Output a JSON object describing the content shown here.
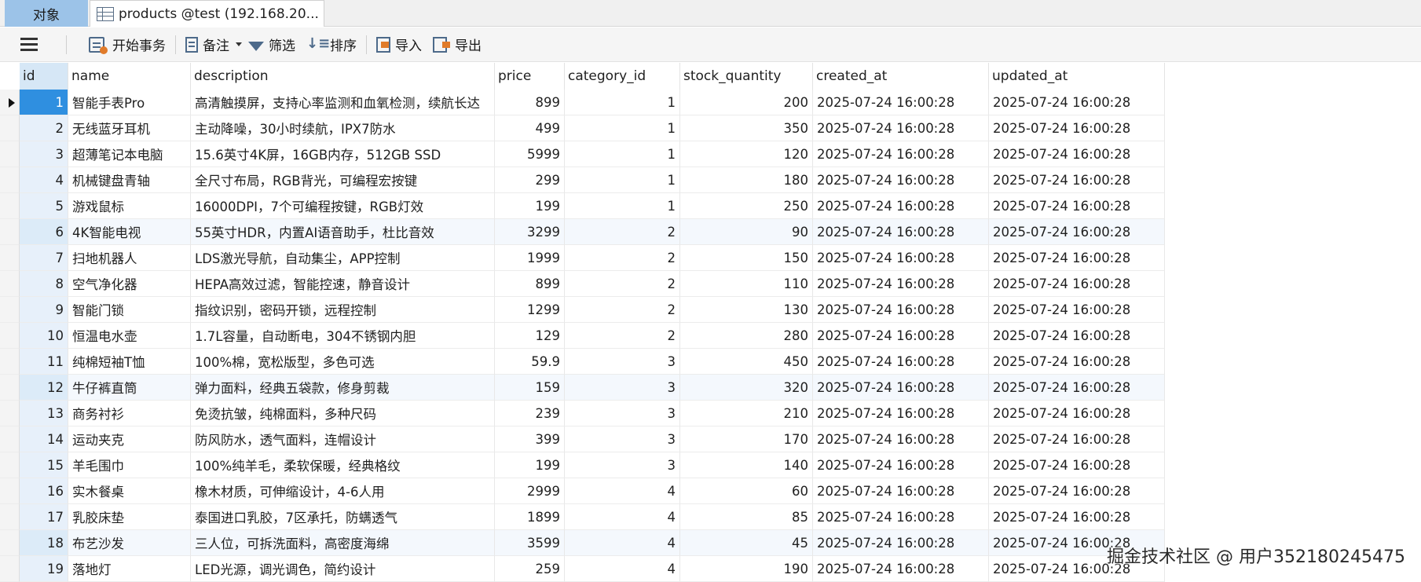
{
  "tabs": {
    "objects": "对象",
    "table": "products @test (192.168.20..."
  },
  "toolbar": {
    "begin_transaction": "开始事务",
    "memo": "备注",
    "filter": "筛选",
    "sort": "排序",
    "import": "导入",
    "export": "导出"
  },
  "grid": {
    "columns": [
      "id",
      "name",
      "description",
      "price",
      "category_id",
      "stock_quantity",
      "created_at",
      "updated_at"
    ],
    "rows": [
      [
        "1",
        "智能手表Pro",
        "高清触摸屏，支持心率监测和血氧检测，续航长达",
        "899",
        "1",
        "200",
        "2025-07-24 16:00:28",
        "2025-07-24 16:00:28"
      ],
      [
        "2",
        "无线蓝牙耳机",
        "主动降噪，30小时续航，IPX7防水",
        "499",
        "1",
        "350",
        "2025-07-24 16:00:28",
        "2025-07-24 16:00:28"
      ],
      [
        "3",
        "超薄笔记本电脑",
        "15.6英寸4K屏，16GB内存，512GB SSD",
        "5999",
        "1",
        "120",
        "2025-07-24 16:00:28",
        "2025-07-24 16:00:28"
      ],
      [
        "4",
        "机械键盘青轴",
        "全尺寸布局，RGB背光，可编程宏按键",
        "299",
        "1",
        "180",
        "2025-07-24 16:00:28",
        "2025-07-24 16:00:28"
      ],
      [
        "5",
        "游戏鼠标",
        "16000DPI，7个可编程按键，RGB灯效",
        "199",
        "1",
        "250",
        "2025-07-24 16:00:28",
        "2025-07-24 16:00:28"
      ],
      [
        "6",
        "4K智能电视",
        "55英寸HDR，内置AI语音助手，杜比音效",
        "3299",
        "2",
        "90",
        "2025-07-24 16:00:28",
        "2025-07-24 16:00:28"
      ],
      [
        "7",
        "扫地机器人",
        "LDS激光导航，自动集尘，APP控制",
        "1999",
        "2",
        "150",
        "2025-07-24 16:00:28",
        "2025-07-24 16:00:28"
      ],
      [
        "8",
        "空气净化器",
        "HEPA高效过滤，智能控速，静音设计",
        "899",
        "2",
        "110",
        "2025-07-24 16:00:28",
        "2025-07-24 16:00:28"
      ],
      [
        "9",
        "智能门锁",
        "指纹识别，密码开锁，远程控制",
        "1299",
        "2",
        "130",
        "2025-07-24 16:00:28",
        "2025-07-24 16:00:28"
      ],
      [
        "10",
        "恒温电水壶",
        "1.7L容量，自动断电，304不锈钢内胆",
        "129",
        "2",
        "280",
        "2025-07-24 16:00:28",
        "2025-07-24 16:00:28"
      ],
      [
        "11",
        "纯棉短袖T恤",
        "100%棉，宽松版型，多色可选",
        "59.9",
        "3",
        "450",
        "2025-07-24 16:00:28",
        "2025-07-24 16:00:28"
      ],
      [
        "12",
        "牛仔裤直筒",
        "弹力面料，经典五袋款，修身剪裁",
        "159",
        "3",
        "320",
        "2025-07-24 16:00:28",
        "2025-07-24 16:00:28"
      ],
      [
        "13",
        "商务衬衫",
        "免烫抗皱，纯棉面料，多种尺码",
        "239",
        "3",
        "210",
        "2025-07-24 16:00:28",
        "2025-07-24 16:00:28"
      ],
      [
        "14",
        "运动夹克",
        "防风防水，透气面料，连帽设计",
        "399",
        "3",
        "170",
        "2025-07-24 16:00:28",
        "2025-07-24 16:00:28"
      ],
      [
        "15",
        "羊毛围巾",
        "100%纯羊毛，柔软保暖，经典格纹",
        "199",
        "3",
        "140",
        "2025-07-24 16:00:28",
        "2025-07-24 16:00:28"
      ],
      [
        "16",
        "实木餐桌",
        "橡木材质，可伸缩设计，4-6人用",
        "2999",
        "4",
        "60",
        "2025-07-24 16:00:28",
        "2025-07-24 16:00:28"
      ],
      [
        "17",
        "乳胶床垫",
        "泰国进口乳胶，7区承托，防螨透气",
        "1899",
        "4",
        "85",
        "2025-07-24 16:00:28",
        "2025-07-24 16:00:28"
      ],
      [
        "18",
        "布艺沙发",
        "三人位，可拆洗面料，高密度海绵",
        "3599",
        "4",
        "45",
        "2025-07-24 16:00:28",
        "2025-07-24 16:00:28"
      ],
      [
        "19",
        "落地灯",
        "LED光源，调光调色，简约设计",
        "259",
        "4",
        "190",
        "2025-07-24 16:00:28",
        "2025-07-24 16:00:28"
      ]
    ],
    "selected_row": 0,
    "alt_rows": [
      5,
      11,
      17
    ]
  },
  "watermark": "掘金技术社区 @ 用户352180245475"
}
